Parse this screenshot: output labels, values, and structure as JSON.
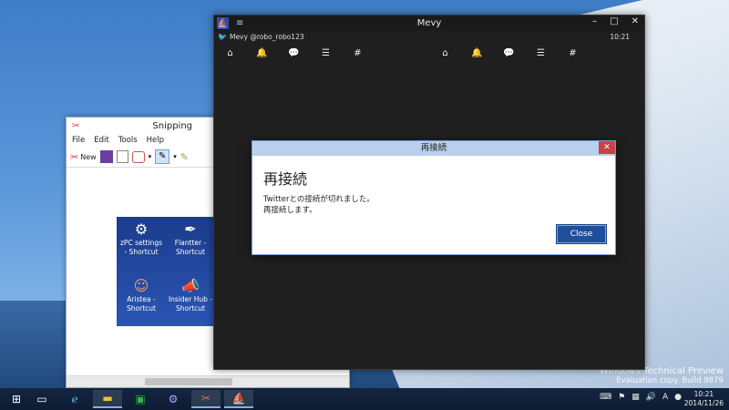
{
  "desktop": {
    "watermark_line1": "Windows Technical Preview",
    "watermark_line2": "Evaluation copy. Build 9879"
  },
  "snipping_tool": {
    "title": "Snipping",
    "menu": [
      "File",
      "Edit",
      "Tools",
      "Help"
    ],
    "new_label": "New",
    "desktop_icons": [
      {
        "label1": "zPC settings",
        "label2": "- Shortcut"
      },
      {
        "label1": "Flantter -",
        "label2": "Shortcut"
      },
      {
        "label1": "Aristea -",
        "label2": "Shortcut"
      },
      {
        "label1": "Insider Hub -",
        "label2": "Shortcut"
      }
    ]
  },
  "mevy": {
    "title": "Mevy",
    "account_app": "Mevy",
    "account_handle": "@robo_robo123",
    "time": "10:21",
    "dialog": {
      "title": "再接続",
      "heading": "再接続",
      "message_line1": "Twitterとの接続が切れました。",
      "message_line2": "再接続します。",
      "close_button": "Close"
    }
  },
  "taskbar": {
    "clock_time": "10:21",
    "clock_date": "2014/11/26"
  }
}
